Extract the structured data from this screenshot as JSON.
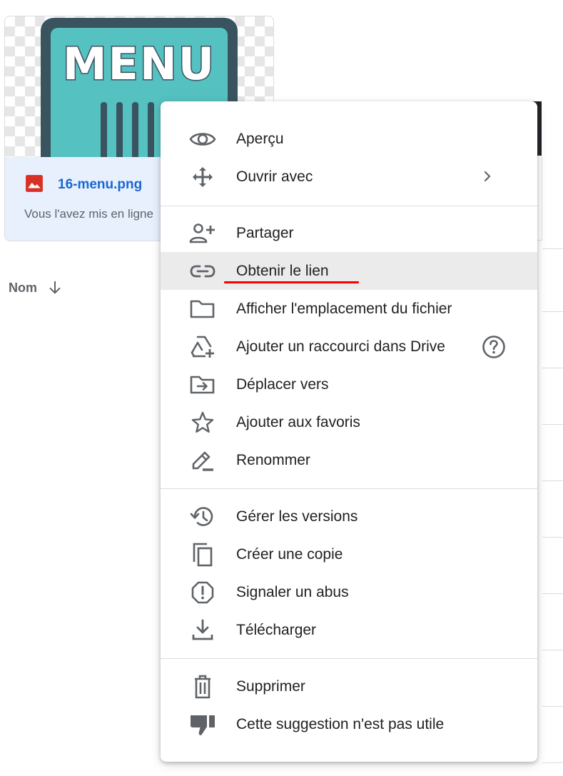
{
  "file_card": {
    "thumbnail_text": "MENU",
    "file_name": "16-menu.png",
    "subtitle": "Vous l'avez mis en ligne"
  },
  "list": {
    "column_name": "Nom"
  },
  "context_menu": {
    "items": [
      {
        "label": "Aperçu",
        "icon": "eye-icon"
      },
      {
        "label": "Ouvrir avec",
        "icon": "move-arrows-icon"
      },
      {
        "label": "Partager",
        "icon": "person-add-icon"
      },
      {
        "label": "Obtenir le lien",
        "icon": "link-icon"
      },
      {
        "label": "Afficher l'emplacement du fichier",
        "icon": "folder-icon"
      },
      {
        "label": "Ajouter un raccourci dans Drive",
        "icon": "drive-shortcut-icon"
      },
      {
        "label": "Déplacer vers",
        "icon": "move-to-folder-icon"
      },
      {
        "label": "Ajouter aux favoris",
        "icon": "star-icon"
      },
      {
        "label": "Renommer",
        "icon": "pencil-icon"
      },
      {
        "label": "Gérer les versions",
        "icon": "history-icon"
      },
      {
        "label": "Créer une copie",
        "icon": "copy-icon"
      },
      {
        "label": "Signaler un abus",
        "icon": "report-icon"
      },
      {
        "label": "Télécharger",
        "icon": "download-icon"
      },
      {
        "label": "Supprimer",
        "icon": "trash-icon"
      },
      {
        "label": "Cette suggestion n'est pas utile",
        "icon": "thumb-down-icon"
      }
    ],
    "highlighted_item": "Obtenir le lien"
  },
  "colors": {
    "highlight_bg": "#ebebeb",
    "underline": "#ff0000",
    "file_name": "#1967d2",
    "card_bg": "#e8f0fe",
    "icon": "#5f6368"
  }
}
